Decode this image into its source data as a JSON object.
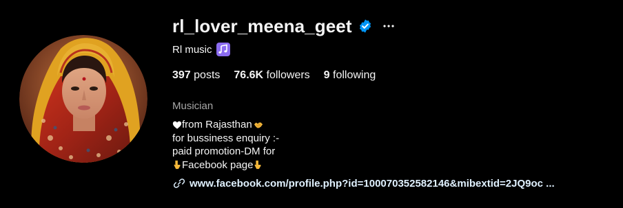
{
  "profile": {
    "username": "rl_lover_meena_geet",
    "full_name": "Rl music",
    "verified": true
  },
  "icons": {
    "verified": "verified-badge-icon",
    "more": "more-options-icon",
    "music": "music-notes-icon",
    "link": "link-icon",
    "heart": "white-heart-icon",
    "hands": "handshake-icon",
    "pointing": "backhand-index-pointing-down-icon"
  },
  "stats": {
    "posts_count": "397",
    "posts_label": " posts",
    "followers_count": "76.6K",
    "followers_label": " followers",
    "following_count": "9",
    "following_label": " following"
  },
  "category": "Musician",
  "bio": {
    "line1": "from Rajasthan",
    "line2": "for bussiness enquiry :-",
    "line3": "paid promotion-DM for",
    "line4": "Facebook page"
  },
  "link": {
    "text": "www.facebook.com/profile.php?id=100070352582146&mibextid=2JQ9oc ..."
  },
  "colors": {
    "background": "#000000",
    "text": "#f5f5f5",
    "muted": "#a8a8a8",
    "verified": "#0095f6",
    "music_icon": "#8b6cf0",
    "link": "#e0f1ff"
  }
}
